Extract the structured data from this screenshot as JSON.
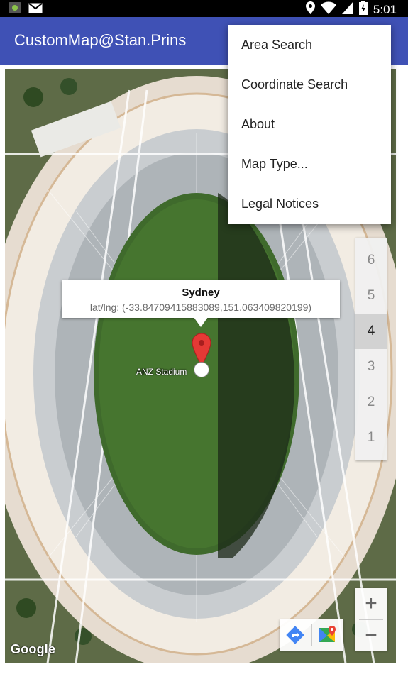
{
  "status_bar": {
    "time": "5:01",
    "icons": [
      "app-notification-icon",
      "mail-icon",
      "location-icon",
      "wifi-icon",
      "signal-icon",
      "battery-icon"
    ]
  },
  "app_bar": {
    "title": "CustomMap@Stan.Prins",
    "color": "#3f51b5"
  },
  "overflow_menu": {
    "items": [
      {
        "label": "Area Search"
      },
      {
        "label": "Coordinate Search"
      },
      {
        "label": "About"
      },
      {
        "label": "Map Type..."
      },
      {
        "label": "Legal Notices"
      }
    ]
  },
  "info_window": {
    "title": "Sydney",
    "snippet": "lat/lng: (-33.84709415883089,151.063409820199)"
  },
  "map": {
    "type": "satellite",
    "place_label": "ANZ Stadium",
    "attribution": "Google",
    "marker_color": "#e53935"
  },
  "level_picker": {
    "levels": [
      "6",
      "5",
      "4",
      "3",
      "2",
      "1"
    ],
    "selected": "4"
  },
  "zoom_controls": {
    "zoom_in": "+",
    "zoom_out": "−"
  },
  "map_toolbar": {
    "icons": [
      "directions-icon",
      "google-maps-icon"
    ]
  }
}
